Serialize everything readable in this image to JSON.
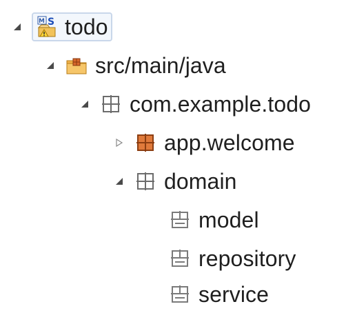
{
  "package_explorer": {
    "project": {
      "label": "todo",
      "icon": "maven-spring-project-icon",
      "expanded": true
    },
    "source_folder": {
      "label": "src/main/java",
      "icon": "source-folder-icon",
      "expanded": true
    },
    "root_package": {
      "label": "com.example.todo",
      "icon": "package-icon",
      "expanded": true
    },
    "packages": [
      {
        "label": "app.welcome",
        "icon": "package-icon-orange",
        "expanded": false
      },
      {
        "label": "domain",
        "icon": "package-icon",
        "expanded": true
      }
    ],
    "domain_children": [
      {
        "label": "model",
        "icon": "empty-package-icon"
      },
      {
        "label": "repository",
        "icon": "empty-package-icon"
      },
      {
        "label": "service",
        "icon": "empty-package-icon"
      }
    ]
  }
}
